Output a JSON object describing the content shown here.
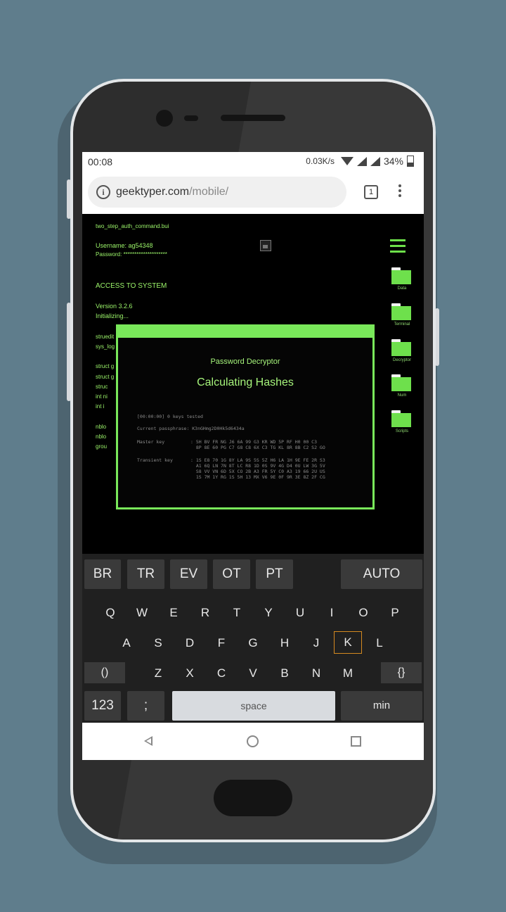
{
  "status_bar": {
    "time": "00:08",
    "network_speed": "0.03K/s",
    "battery": "34%"
  },
  "browser": {
    "url_domain": "geektyper.com",
    "url_path": "/mobile/",
    "tab_count": "1"
  },
  "terminal": {
    "file_name": "two_step_auth_command.bui",
    "username_line": "Username: ag54348",
    "password_line": "Password: ********************",
    "access_line": "ACCESS TO SYSTEM",
    "version_line": "Version 3.2.6",
    "init_line": "Initializing...",
    "code_lines": [
      "struedit",
      "sys_log",
      "",
      "struct g",
      "struct g",
      "  struc",
      "  int ni",
      "  int i",
      "",
      "  nblo",
      "  nblo",
      "  grou"
    ]
  },
  "side_menu": {
    "folders": [
      "Data",
      "Terminal",
      "Decryptor",
      "Num",
      "Scripts"
    ]
  },
  "decryptor": {
    "title": "Password Decryptor",
    "subtitle": "Calculating Hashes",
    "keys_tested": "[00:00:00] 0 keys tested",
    "current_passphrase": "Current passphrase: K3nGHmg2D0Hk5d6434a",
    "master_key_label": "Master key",
    "master_key_rows": [
      ": 5H BV FR NG J6 6A 99 G3 KR WD 5P RF H0 00 C3",
      "  8P 8E 60 PG C7 G8 C8 6X C3 TG KL 8R 8B C2 S2 GO"
    ],
    "transient_key_label": "Transient key",
    "transient_key_rows": [
      ": 1S E8 70 1G 8Y LA 9S 5S 5Z H6 LA 1H 9E FE 2R S3",
      "  A1 6Q LN 7N 8T LC R8 1D 0S 9V 4G D4 0U LW 3G 5V",
      "  S8 VV VN 6D 5X CO 2B A3 FR 5Y C0 A3 19 66 2U US",
      "  1S 7M 1Y RG 1S 5H 13 MX V6 9E 0F 9R 3E 8Z 2F CG"
    ]
  },
  "keyboard": {
    "top_row": [
      "BR",
      "TR",
      "EV",
      "OT",
      "PT"
    ],
    "auto_label": "AUTO",
    "row1": [
      "Q",
      "W",
      "E",
      "R",
      "T",
      "Y",
      "U",
      "I",
      "O",
      "P"
    ],
    "row2": [
      "A",
      "S",
      "D",
      "F",
      "G",
      "H",
      "J",
      "K",
      "L"
    ],
    "row3": [
      "Z",
      "X",
      "C",
      "V",
      "B",
      "N",
      "M"
    ],
    "parens_label": "()",
    "braces_label": "{}",
    "num_label": "123",
    "semicolon_label": ";",
    "space_label": "space",
    "min_label": "min"
  },
  "colors": {
    "terminal_green": "#79e85a",
    "keyboard_bg": "#202020",
    "highlight_key_border": "#d58a20"
  }
}
